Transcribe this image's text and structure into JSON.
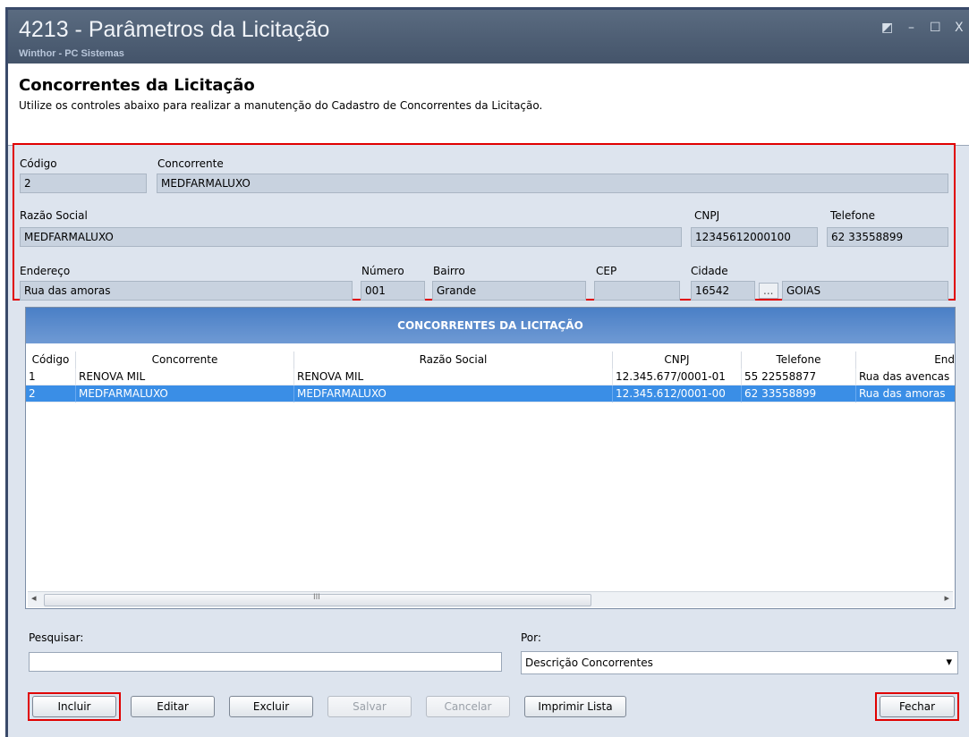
{
  "window": {
    "title": "4213 - Parâmetros da Licitação",
    "subtitle": "Winthor - PC Sistemas",
    "controls": [
      "◩",
      "–",
      "☐",
      "X"
    ]
  },
  "header": {
    "title": "Concorrentes da Licitação",
    "description": "Utilize os controles abaixo para realizar a manutenção do Cadastro de Concorrentes da Licitação."
  },
  "form": {
    "codigo_label": "Código",
    "codigo_value": "2",
    "concorrente_label": "Concorrente",
    "concorrente_value": "MEDFARMALUXO",
    "razao_label": "Razão Social",
    "razao_value": "MEDFARMALUXO",
    "cnpj_label": "CNPJ",
    "cnpj_value": "12345612000100",
    "telefone_label": "Telefone",
    "telefone_value": "62 33558899",
    "endereco_label": "Endereço",
    "endereco_value": "Rua das amoras",
    "numero_label": "Número",
    "numero_value": "001",
    "bairro_label": "Bairro",
    "bairro_value": "Grande",
    "cep_label": "CEP",
    "cep_value": "",
    "cidade_label": "Cidade",
    "cidade_code": "16542",
    "cidade_lookup": "...",
    "cidade_name": "GOIAS"
  },
  "grid": {
    "title": "CONCORRENTES DA LICITAÇÃO",
    "columns": [
      "Código",
      "Concorrente",
      "Razão Social",
      "CNPJ",
      "Telefone",
      "End"
    ],
    "rows": [
      [
        "1",
        "RENOVA MIL",
        "RENOVA MIL",
        "12.345.677/0001-01",
        "55 22558877",
        "Rua das avencas"
      ],
      [
        "2",
        "MEDFARMALUXO",
        "MEDFARMALUXO",
        "12.345.612/0001-00",
        "62 33558899",
        "Rua das amoras"
      ]
    ],
    "scroll_left": "◂",
    "scroll_grip": "III",
    "scroll_right": "▸"
  },
  "search": {
    "label": "Pesquisar:",
    "value": "",
    "por_label": "Por:",
    "por_value": "Descrição Concorrentes",
    "dropdown_icon": "▾"
  },
  "buttons": {
    "incluir": "Incluir",
    "editar": "Editar",
    "excluir": "Excluir",
    "salvar": "Salvar",
    "cancelar": "Cancelar",
    "imprimir": "Imprimir Lista",
    "fechar": "Fechar"
  },
  "colors": {
    "highlight_red": "#e00000",
    "selected_row": "#3a8ee6",
    "grid_header": "#4a7fc6"
  }
}
